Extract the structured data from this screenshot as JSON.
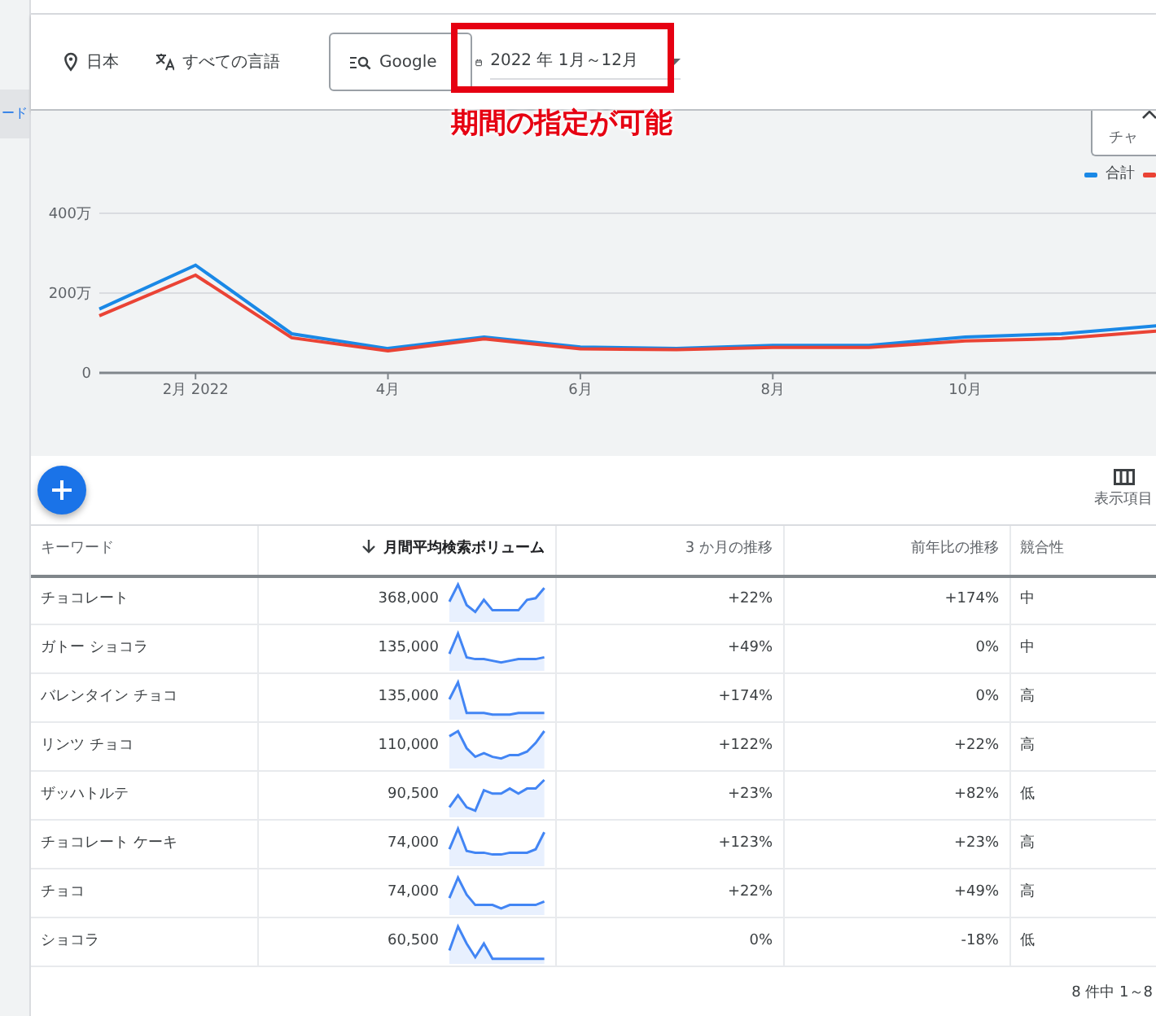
{
  "sidebar": {
    "items": [
      {
        "label": "ード",
        "selected": true
      }
    ]
  },
  "filters": {
    "location": "日本",
    "language": "すべての言語",
    "network": "Google",
    "date_range": "2022 年 1月～12月"
  },
  "annotation": {
    "text": "期間の指定が可能"
  },
  "chart_toggle": {
    "label": "チャ"
  },
  "chart": {
    "chart_data": {
      "type": "line",
      "categories": [
        null,
        "2月 2022",
        null,
        "4月",
        null,
        "6月",
        null,
        "8月",
        null,
        "10月",
        null,
        null
      ],
      "yticks": [
        {
          "value": 0,
          "label": "0"
        },
        {
          "value": 200,
          "label": "200万"
        },
        {
          "value": 400,
          "label": "400万"
        }
      ],
      "ylim": [
        0,
        400
      ],
      "series": [
        {
          "name": "合計",
          "color": "#1a88e6",
          "values": [
            160,
            270,
            98,
            61,
            90,
            65,
            61,
            69,
            69,
            90,
            98,
            118
          ]
        },
        {
          "color": "#ea4335",
          "values": [
            143,
            245,
            88,
            55,
            85,
            60,
            58,
            64,
            64,
            80,
            86,
            105
          ]
        }
      ]
    }
  },
  "toolbar": {
    "columns_label": "表示項目"
  },
  "table": {
    "columns": [
      {
        "label": "キーワード",
        "sorted": false
      },
      {
        "label": "月間平均検索ボリューム",
        "sorted": true
      },
      {
        "label": "3 か月の推移",
        "sorted": false
      },
      {
        "label": "前年比の推移",
        "sorted": false
      },
      {
        "label": "競合性",
        "sorted": false
      }
    ],
    "rows": [
      {
        "keyword": "チョコレート",
        "volume": "368,000",
        "three_month": "+22%",
        "yoy": "+174%",
        "competition": "中"
      },
      {
        "keyword": "ガトー ショコラ",
        "volume": "135,000",
        "three_month": "+49%",
        "yoy": "0%",
        "competition": "中"
      },
      {
        "keyword": "バレンタイン チョコ",
        "volume": "135,000",
        "three_month": "+174%",
        "yoy": "0%",
        "competition": "高"
      },
      {
        "keyword": "リンツ チョコ",
        "volume": "110,000",
        "three_month": "+122%",
        "yoy": "+22%",
        "competition": "高"
      },
      {
        "keyword": "ザッハトルテ",
        "volume": "90,500",
        "three_month": "+23%",
        "yoy": "+82%",
        "competition": "低"
      },
      {
        "keyword": "チョコレート ケーキ",
        "volume": "74,000",
        "three_month": "+123%",
        "yoy": "+23%",
        "competition": "高"
      },
      {
        "keyword": "チョコ",
        "volume": "74,000",
        "three_month": "+22%",
        "yoy": "+49%",
        "competition": "高"
      },
      {
        "keyword": "ショコラ",
        "volume": "60,500",
        "three_month": "0%",
        "yoy": "-18%",
        "competition": "低"
      }
    ]
  },
  "pagination": "8 件中 1～8"
}
